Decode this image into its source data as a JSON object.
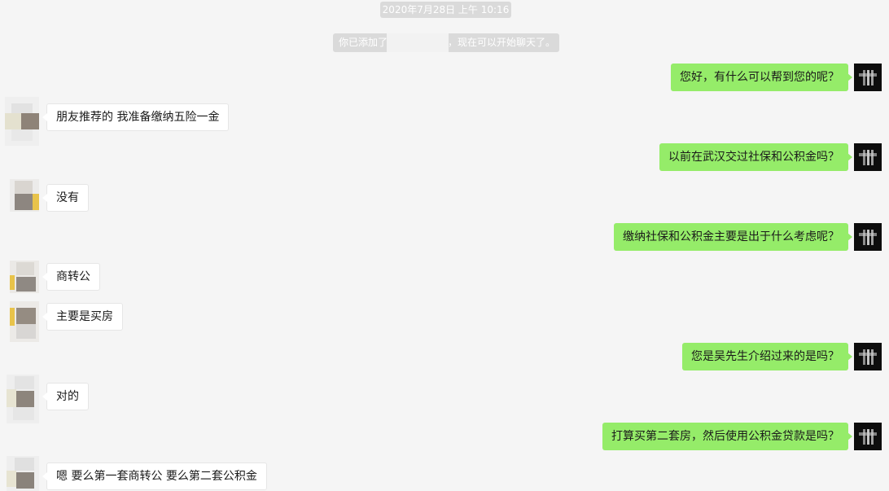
{
  "system": {
    "time": "2020年7月28日 上午 10:16",
    "added_prefix": "你已添加了",
    "added_suffix": "，现在可以开始聊天了。"
  },
  "messages": [
    {
      "side": "right",
      "text": "您好，有什么可以帮到您的呢？"
    },
    {
      "side": "left",
      "text": "朋友推荐的 我准备缴纳五险一金"
    },
    {
      "side": "right",
      "text": "以前在武汉交过社保和公积金吗？"
    },
    {
      "side": "left",
      "text": "没有"
    },
    {
      "side": "right",
      "text": "缴纳社保和公积金主要是出于什么考虑呢？"
    },
    {
      "side": "left",
      "text": "商转公"
    },
    {
      "side": "left",
      "text": "主要是买房"
    },
    {
      "side": "right",
      "text": "您是吴先生介绍过来的是吗？"
    },
    {
      "side": "left",
      "text": "对的"
    },
    {
      "side": "right",
      "text": "打算买第二套房，然后使用公积金贷款是吗？"
    },
    {
      "side": "left",
      "text": "嗯 要么第一套商转公 要么第二套公积金"
    }
  ],
  "colors": {
    "background": "#f5f5f5",
    "bubble_self": "#95ec69",
    "bubble_other": "#ffffff",
    "system_pill": "#dadada"
  }
}
